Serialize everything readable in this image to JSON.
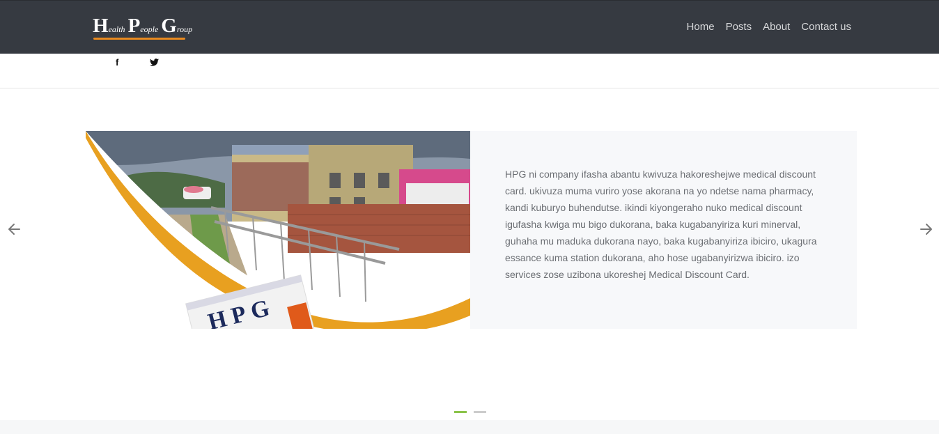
{
  "header": {
    "logo": {
      "letters": [
        {
          "cap": "H",
          "rest": "ealth"
        },
        {
          "cap": "P",
          "rest": "eople"
        },
        {
          "cap": "G",
          "rest": "roup"
        }
      ],
      "underline_color": "#e98a1f"
    },
    "nav": [
      {
        "label": "Home"
      },
      {
        "label": "Posts"
      },
      {
        "label": "About"
      },
      {
        "label": "Contact us"
      }
    ]
  },
  "social": {
    "facebook_glyph": "f",
    "facebook_icon": "facebook-icon",
    "twitter_icon": "twitter-icon"
  },
  "slider": {
    "slide": {
      "image_caption_text": "HPG",
      "text": "HPG ni company ifasha abantu kwivuza hakoreshejwe medical discount card. ukivuza muma vuriro yose akorana na yo ndetse nama pharmacy, kandi kuburyo buhendutse. ikindi kiyongeraho nuko medical discount igufasha kwiga mu bigo dukorana, baka kugabanyiriza kuri minerval, guhaha mu maduka dukorana nayo, baka kugabanyiriza ibiciro, ukagura essance kuma station dukorana, aho hose ugabanyirizwa ibiciro. izo services zose uzibona ukoreshej Medical Discount Card."
    },
    "prev_icon": "arrow-left-icon",
    "next_icon": "arrow-right-icon",
    "slide_count": 2,
    "active_slide": 1,
    "colors": {
      "accent": "#8bc34a",
      "inactive": "#cccccc",
      "header_bg": "#363a41"
    }
  }
}
